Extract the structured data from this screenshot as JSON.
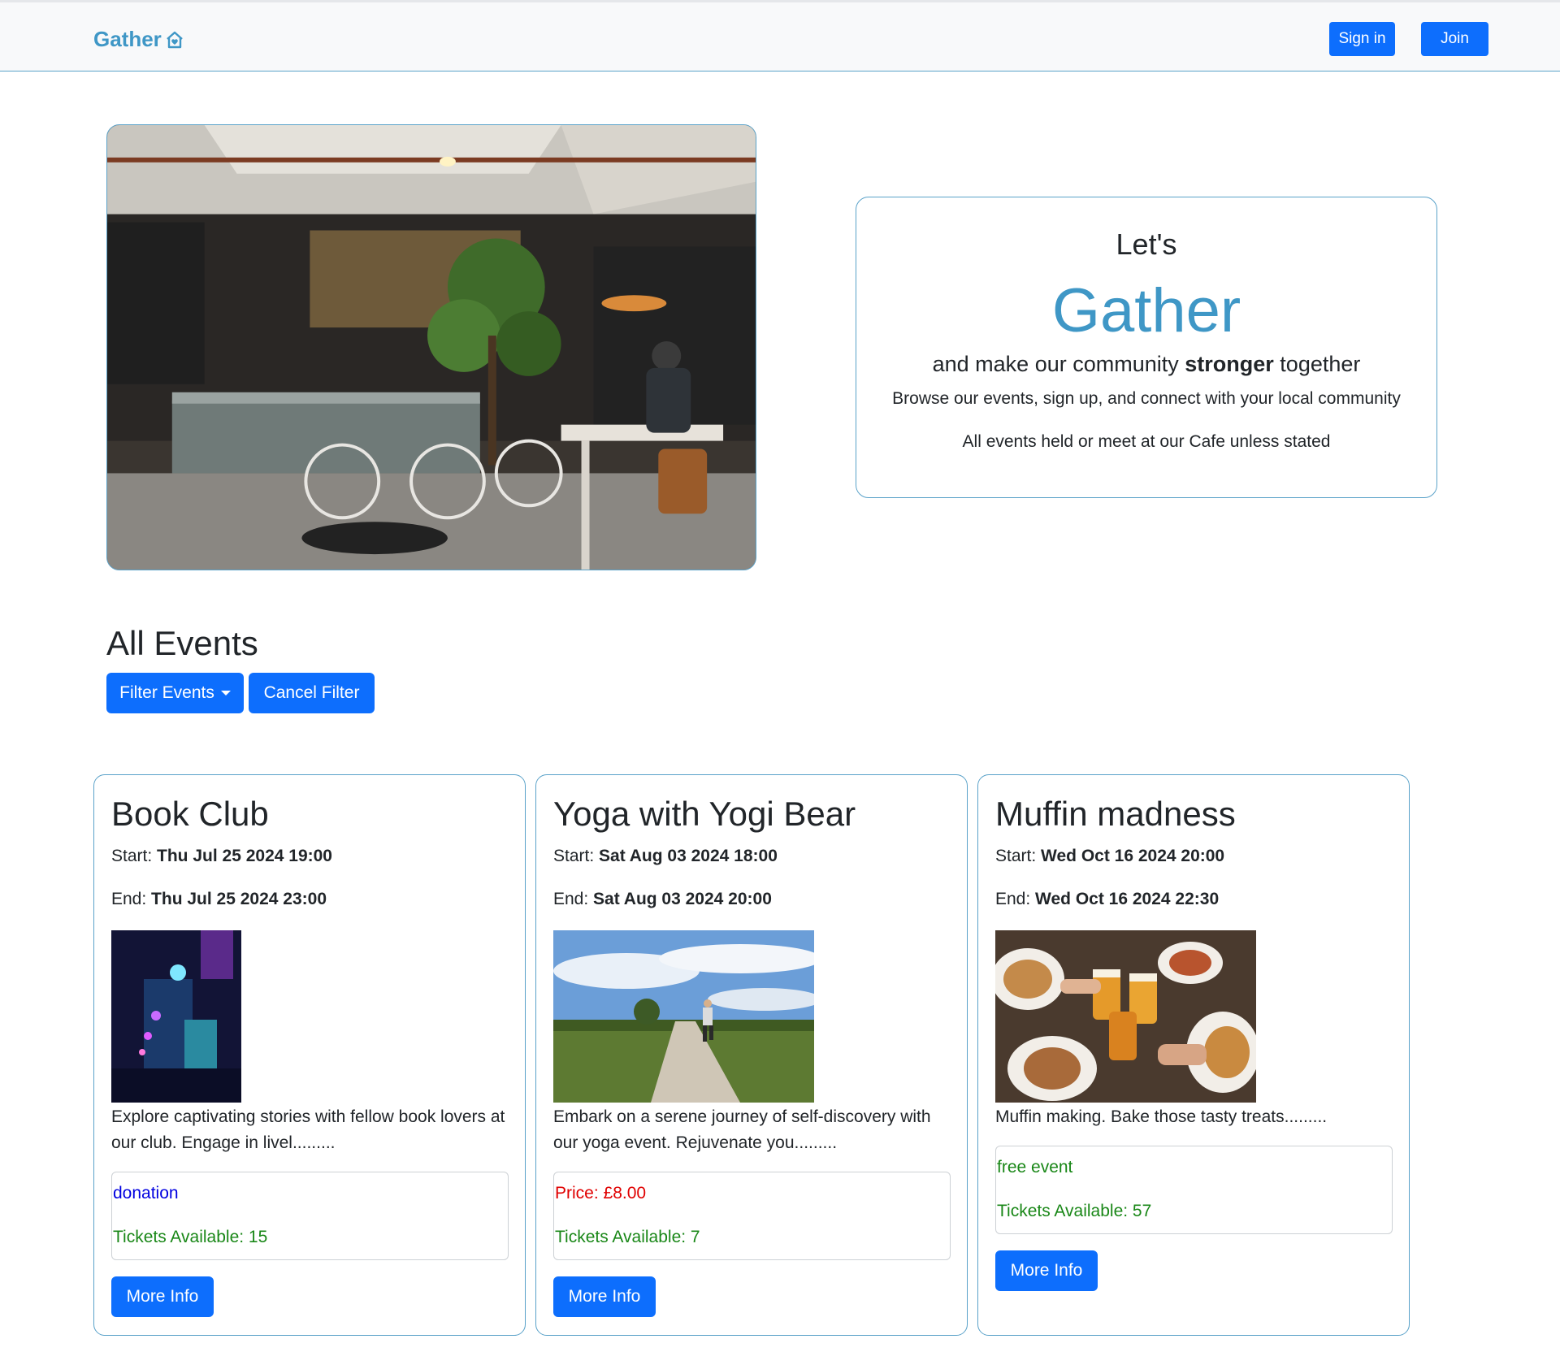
{
  "nav": {
    "brand": "Gather",
    "signin_label": "Sign in",
    "join_label": "Join"
  },
  "hero": {
    "lets": "Let's",
    "gather": "Gather",
    "tagline_pre": "and make our community ",
    "tagline_bold": "stronger",
    "tagline_post": " together",
    "browse": "Browse our events, sign up, and connect with your local community",
    "held": "All events held or meet at our Cafe unless stated"
  },
  "events_section": {
    "title": "All Events",
    "filter_label": "Filter Events",
    "cancel_label": "Cancel Filter"
  },
  "events": [
    {
      "title": "Book Club",
      "start_label": "Start: ",
      "start": "Thu Jul 25 2024 19:00",
      "end_label": "End: ",
      "end": "Thu Jul 25 2024 23:00",
      "description": "Explore captivating stories with fellow book lovers at our club. Engage in livel.........",
      "price_text": "donation",
      "price_color": "#0000e0",
      "tickets": "Tickets Available: 15",
      "more_label": "More Info",
      "image_icon": "neon-lights-image"
    },
    {
      "title": "Yoga with Yogi Bear",
      "start_label": "Start: ",
      "start": "Sat Aug 03 2024 18:00",
      "end_label": "End: ",
      "end": "Sat Aug 03 2024 20:00",
      "description": "Embark on a serene journey of self-discovery with our yoga event. Rejuvenate you.........",
      "price_text": "Price: £8.00",
      "price_color": "#e00000",
      "tickets": "Tickets Available: 7",
      "more_label": "More Info",
      "image_icon": "runner-path-image"
    },
    {
      "title": "Muffin madness",
      "start_label": "Start: ",
      "start": "Wed Oct 16 2024 20:00",
      "end_label": "End: ",
      "end": "Wed Oct 16 2024 22:30",
      "description": "Muffin making. Bake those tasty treats.........",
      "price_text": "free event",
      "price_color": "#198717",
      "tickets": "Tickets Available: 57",
      "more_label": "More Info",
      "image_icon": "food-and-drinks-image"
    }
  ],
  "colors": {
    "brand": "#3f97c6",
    "primary": "#0d6efd",
    "available": "#198717"
  }
}
